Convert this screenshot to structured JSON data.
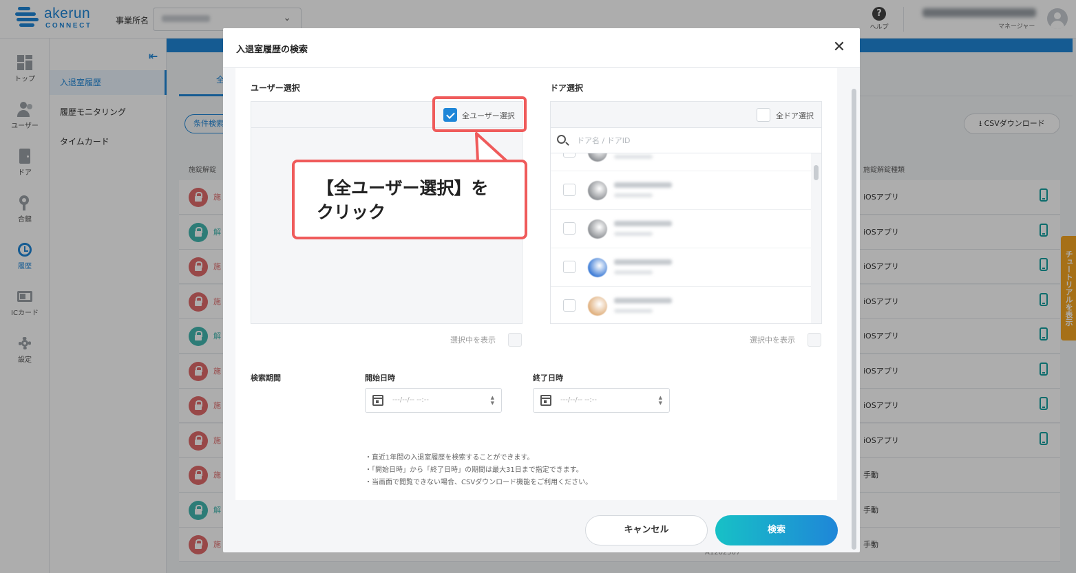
{
  "app": {
    "logo_name": "akerun",
    "logo_sub": "CONNECT",
    "office_label": "事業所名",
    "help_label": "ヘルプ",
    "user_role": "マネージャー"
  },
  "nav": {
    "items": [
      {
        "label": "トップ",
        "icon": "dashboard-icon"
      },
      {
        "label": "ユーザー",
        "icon": "users-icon"
      },
      {
        "label": "ドア",
        "icon": "door-icon"
      },
      {
        "label": "合鍵",
        "icon": "key-icon"
      },
      {
        "label": "履歴",
        "icon": "history-icon"
      },
      {
        "label": "ICカード",
        "icon": "ic-card-icon"
      },
      {
        "label": "設定",
        "icon": "gear-icon"
      }
    ]
  },
  "subnav": {
    "items": [
      "入退室履歴",
      "履歴モニタリング",
      "タイムカード"
    ]
  },
  "content": {
    "tab_label": "全",
    "cond_button": "条件検索",
    "csv_button": "CSVダウンロード",
    "col_lock": "施錠解錠",
    "col_method": "施錠解錠種類",
    "footer_id": "A1202507",
    "rows": [
      {
        "type": "lock",
        "kind": "施",
        "method": "iOSアプリ",
        "phone": true
      },
      {
        "type": "unlock",
        "kind": "解",
        "method": "iOSアプリ",
        "phone": true
      },
      {
        "type": "lock",
        "kind": "施",
        "method": "iOSアプリ",
        "phone": true
      },
      {
        "type": "lock",
        "kind": "施",
        "method": "iOSアプリ",
        "phone": true
      },
      {
        "type": "unlock",
        "kind": "解",
        "method": "iOSアプリ",
        "phone": true
      },
      {
        "type": "lock",
        "kind": "施",
        "method": "iOSアプリ",
        "phone": true
      },
      {
        "type": "lock",
        "kind": "施",
        "method": "iOSアプリ",
        "phone": true
      },
      {
        "type": "lock",
        "kind": "施",
        "method": "iOSアプリ",
        "phone": true
      },
      {
        "type": "lock",
        "kind": "施",
        "method": "手動",
        "phone": false
      },
      {
        "type": "unlock",
        "kind": "解",
        "method": "手動",
        "phone": false
      },
      {
        "type": "lock",
        "kind": "施",
        "method": "手動",
        "phone": false
      }
    ]
  },
  "tutorial_label": "チュートリアルを表示",
  "modal": {
    "title": "入退室履歴の検索",
    "user_section": "ユーザー選択",
    "all_users_label": "全ユーザー選択",
    "all_users_checked": true,
    "door_section": "ドア選択",
    "all_doors_label": "全ドア選択",
    "all_doors_checked": false,
    "door_search_placeholder": "ドア名 / ドアID",
    "show_selected_label": "選択中を表示",
    "period_label": "検索期間",
    "start_label": "開始日時",
    "end_label": "終了日時",
    "date_placeholder": "---/--/-- --:--",
    "notes": [
      "・直近1年間の入退室履歴を検索することができます。",
      "・「開始日時」から「終了日時」の期間は最大31日まで指定できます。",
      "・当画面で閲覧できない場合、CSVダウンロード機能をご利用ください。"
    ],
    "cancel_label": "キャンセル",
    "search_label": "検索",
    "door_thumbs": [
      "#8f9296",
      "#8f9296",
      "#8f9296",
      "#3d7cd6",
      "#e0b07e"
    ]
  },
  "callout": {
    "line1": "【全ユーザー選択】を",
    "line2": "クリック",
    "accent": "#ef5b5b"
  }
}
